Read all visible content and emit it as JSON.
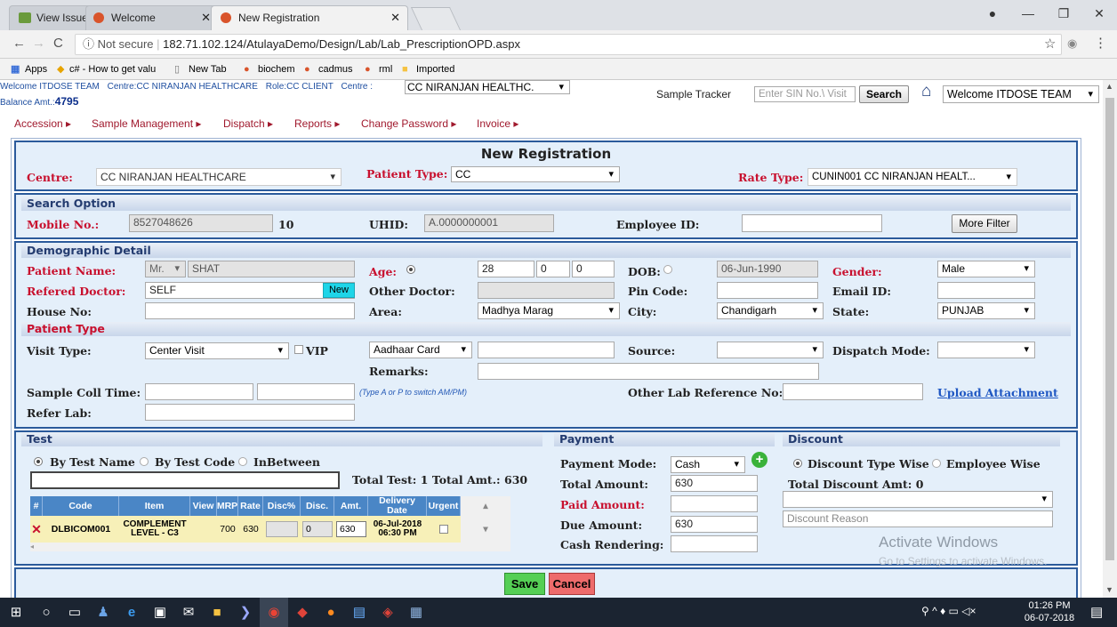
{
  "browser": {
    "tabs": [
      {
        "title": "View Issues - MantisBT"
      },
      {
        "title": "Welcome"
      },
      {
        "title": "New Registration"
      }
    ],
    "url_prefix": "Not secure",
    "url": "182.71.102.124/AtulayaDemo/Design/Lab/Lab_PrescriptionOPD.aspx",
    "bookmarks": [
      "Apps",
      "c# - How to get valu",
      "New Tab",
      "biochem",
      "cadmus",
      "rml",
      "Imported"
    ]
  },
  "header": {
    "welcome": "Welcome ITDOSE TEAM",
    "centre_label": "Centre:CC NIRANJAN HEALTHCARE",
    "role_label": "Role:CC CLIENT",
    "centre_select_label": "Centre :",
    "centre_select_value": "CC NIRANJAN HEALTHC.",
    "balance_label": "Balance Amt.:",
    "balance_value": "4795",
    "sample_tracker_label": "Sample Tracker",
    "sample_tracker_placeholder": "Enter SIN No.\\ Visit",
    "search_button": "Search",
    "welcome_select": "Welcome ITDOSE TEAM"
  },
  "menu": [
    "Accession",
    "Sample Management",
    "Dispatch",
    "Reports",
    "Change Password",
    "Invoice"
  ],
  "form": {
    "title": "New Registration",
    "centre_label": "Centre:",
    "centre_value": "CC NIRANJAN HEALTHCARE",
    "patient_type_label": "Patient Type:",
    "patient_type_value": "CC",
    "rate_type_label": "Rate Type:",
    "rate_type_value": "CUNIN001 CC NIRANJAN HEALT..."
  },
  "search": {
    "title": "Search Option",
    "mobile_label": "Mobile No.:",
    "mobile_value": "8527048626",
    "mobile_count": "10",
    "uhid_label": "UHID:",
    "uhid_value": "A.0000000001",
    "employee_label": "Employee ID:",
    "more_filter": "More Filter"
  },
  "demo": {
    "title": "Demographic Detail",
    "patient_name_label": "Patient Name:",
    "title_value": "Mr.",
    "name_value": "SHAT",
    "age_label": "Age:",
    "age_y": "28",
    "age_m": "0",
    "age_d": "0",
    "dob_label": "DOB:",
    "dob_value": "06-Jun-1990",
    "gender_label": "Gender:",
    "gender_value": "Male",
    "doctor_label": "Refered Doctor:",
    "doctor_value": "SELF",
    "new_button": "New",
    "other_doctor_label": "Other Doctor:",
    "pin_label": "Pin Code:",
    "email_label": "Email ID:",
    "house_label": "House No:",
    "area_label": "Area:",
    "area_value": "Madhya Marag",
    "city_label": "City:",
    "city_value": "Chandigarh",
    "state_label": "State:",
    "state_value": "PUNJAB"
  },
  "ptype": {
    "title": "Patient Type",
    "visit_label": "Visit Type:",
    "visit_value": "Center Visit",
    "vip_label": "VIP",
    "id_type": "Aadhaar Card",
    "source_label": "Source:",
    "dispatch_label": "Dispatch Mode:",
    "remarks_label": "Remarks:",
    "coll_label": "Sample Coll Time:",
    "ampm_hint": "(Type A or P to switch AM/PM)",
    "other_lab_label": "Other Lab Reference No:",
    "upload_link": "Upload Attachment",
    "refer_lab_label": "Refer Lab:"
  },
  "test": {
    "title": "Test",
    "opt1": "By Test Name",
    "opt2": "By Test Code",
    "opt3": "InBetween",
    "totals": "Total Test: 1  Total Amt.: 630",
    "columns": [
      "#",
      "Code",
      "Item",
      "View",
      "MRP",
      "Rate",
      "Disc%",
      "Disc.",
      "Amt.",
      "Delivery Date",
      "Urgent"
    ],
    "row": {
      "code": "DLBICOM001",
      "item": "COMPLEMENT LEVEL - C3",
      "mrp": "700",
      "rate": "630",
      "disc": "0",
      "amt": "630",
      "delivery": "06-Jul-2018 06:30 PM"
    }
  },
  "payment": {
    "title": "Payment",
    "mode_label": "Payment Mode:",
    "mode_value": "Cash",
    "total_label": "Total Amount:",
    "total_value": "630",
    "paid_label": "Paid Amount:",
    "due_label": "Due Amount:",
    "due_value": "630",
    "cash_label": "Cash Rendering:"
  },
  "discount": {
    "title": "Discount",
    "opt1": "Discount Type Wise",
    "opt2": "Employee Wise",
    "total": "Total Discount Amt: 0",
    "reason_placeholder": "Discount Reason"
  },
  "actions": {
    "save": "Save",
    "cancel": "Cancel"
  },
  "watermark": {
    "line1": "Activate Windows",
    "line2": "Go to Settings to activate Windows."
  },
  "clock": {
    "time": "01:26 PM",
    "date": "06-07-2018"
  }
}
